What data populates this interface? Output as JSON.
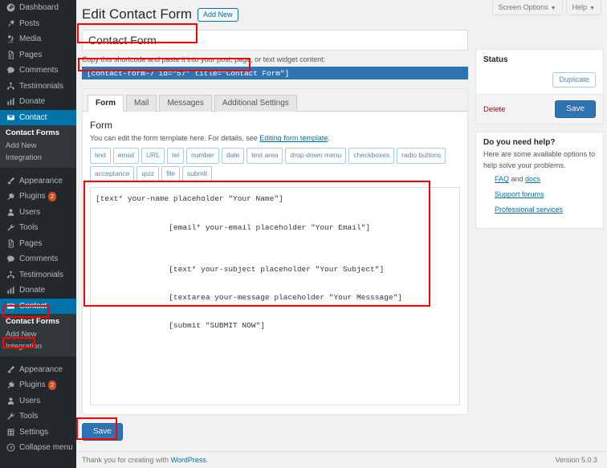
{
  "screen_meta": {
    "screen_options_label": "Screen Options",
    "help_label": "Help",
    "caret": "▼"
  },
  "sidebar": {
    "items": [
      {
        "label": "Dashboard",
        "icon": "dashboard-icon",
        "type": "top"
      },
      {
        "label": "Posts",
        "icon": "pin-icon",
        "type": "top"
      },
      {
        "label": "Media",
        "icon": "media-icon",
        "type": "top"
      },
      {
        "label": "Pages",
        "icon": "page-icon",
        "type": "top"
      },
      {
        "label": "Comments",
        "icon": "comment-icon",
        "type": "top"
      },
      {
        "label": "Testimonials",
        "icon": "testimonials-icon",
        "type": "top"
      },
      {
        "label": "Donate",
        "icon": "chart-bar-icon",
        "type": "top"
      },
      {
        "label": "Contact",
        "icon": "envelope-icon",
        "type": "top",
        "current": true
      },
      {
        "label": "Contact Forms",
        "type": "sub",
        "current": true
      },
      {
        "label": "Add New",
        "type": "sub"
      },
      {
        "label": "Integration",
        "type": "sub"
      },
      {
        "label": "Appearance",
        "icon": "brush-icon",
        "type": "top",
        "gap": true
      },
      {
        "label": "Plugins",
        "icon": "plugins-icon",
        "type": "top",
        "badge": "2"
      },
      {
        "label": "Users",
        "icon": "users-icon",
        "type": "top"
      },
      {
        "label": "Tools",
        "icon": "tools-icon",
        "type": "top"
      },
      {
        "label": "Pages",
        "icon": "page-icon",
        "type": "top"
      },
      {
        "label": "Comments",
        "icon": "comment-icon",
        "type": "top"
      },
      {
        "label": "Testimonials",
        "icon": "testimonials-icon",
        "type": "top"
      },
      {
        "label": "Donate",
        "icon": "chart-bar-icon",
        "type": "top"
      },
      {
        "label": "Contact",
        "icon": "envelope-icon",
        "type": "top",
        "current": true
      },
      {
        "label": "Contact Forms",
        "type": "sub",
        "current": true
      },
      {
        "label": "Add New",
        "type": "sub"
      },
      {
        "label": "Integration",
        "type": "sub"
      },
      {
        "label": "Appearance",
        "icon": "brush-icon",
        "type": "top",
        "gap": true
      },
      {
        "label": "Plugins",
        "icon": "plugins-icon",
        "type": "top",
        "badge": "2"
      },
      {
        "label": "Users",
        "icon": "users-icon",
        "type": "top"
      },
      {
        "label": "Tools",
        "icon": "tools-icon",
        "type": "top"
      },
      {
        "label": "Settings",
        "icon": "settings-icon",
        "type": "top"
      },
      {
        "label": "Collapse menu",
        "icon": "collapse-icon",
        "type": "top"
      }
    ]
  },
  "page": {
    "title": "Edit Contact Form",
    "add_new_label": "Add New",
    "form_title_value": "Contact Form",
    "shortcode_label": "Copy this shortcode and paste it into your post, page, or text widget content:",
    "shortcode_value": "[contact-form-7 id=\"57\" title=\"Contact Form\"]"
  },
  "tabs": [
    {
      "label": "Form",
      "active": true
    },
    {
      "label": "Mail",
      "active": false
    },
    {
      "label": "Messages",
      "active": false
    },
    {
      "label": "Additional Settings",
      "active": false
    }
  ],
  "form_panel": {
    "heading": "Form",
    "description_prefix": "You can edit the form template here. For details, see ",
    "description_link": "Editing form template",
    "description_suffix": ".",
    "tag_buttons": [
      "text",
      "email",
      "URL",
      "tel",
      "number",
      "date",
      "text area",
      "drop-down menu",
      "checkboxes",
      "radio buttons",
      "acceptance",
      "quiz",
      "file",
      "submit"
    ],
    "template_value": "[text* your-name placeholder \"Your Name\"]\n\n                [email* your-email placeholder \"Your Email\"]\n\n\n                [text* your-subject placeholder \"Your Subject\"]\n\n                [textarea your-message placeholder \"Your Messsage\"]\n\n                [submit \"SUBMIT NOW\"]"
  },
  "bottom_save_label": "Save",
  "status_box": {
    "title": "Status",
    "duplicate_label": "Duplicate",
    "delete_label": "Delete",
    "save_label": "Save"
  },
  "help_box": {
    "title": "Do you need help?",
    "body": "Here are some available options to help solve your problems.",
    "link_faq": "FAQ",
    "and_text": " and ",
    "link_docs": "docs",
    "link_support": "Support forums",
    "link_professional": "Professional services"
  },
  "footer": {
    "thanks_prefix": "Thank you for creating with ",
    "thanks_link": "WordPress",
    "thanks_suffix": ".",
    "version": "Version 5.0.3"
  },
  "colors": {
    "accent": "#0073aa",
    "primary_button": "#2e74b5",
    "annotation": "#ff0000",
    "danger": "#a00000",
    "sidebar_bg": "#23282d"
  }
}
